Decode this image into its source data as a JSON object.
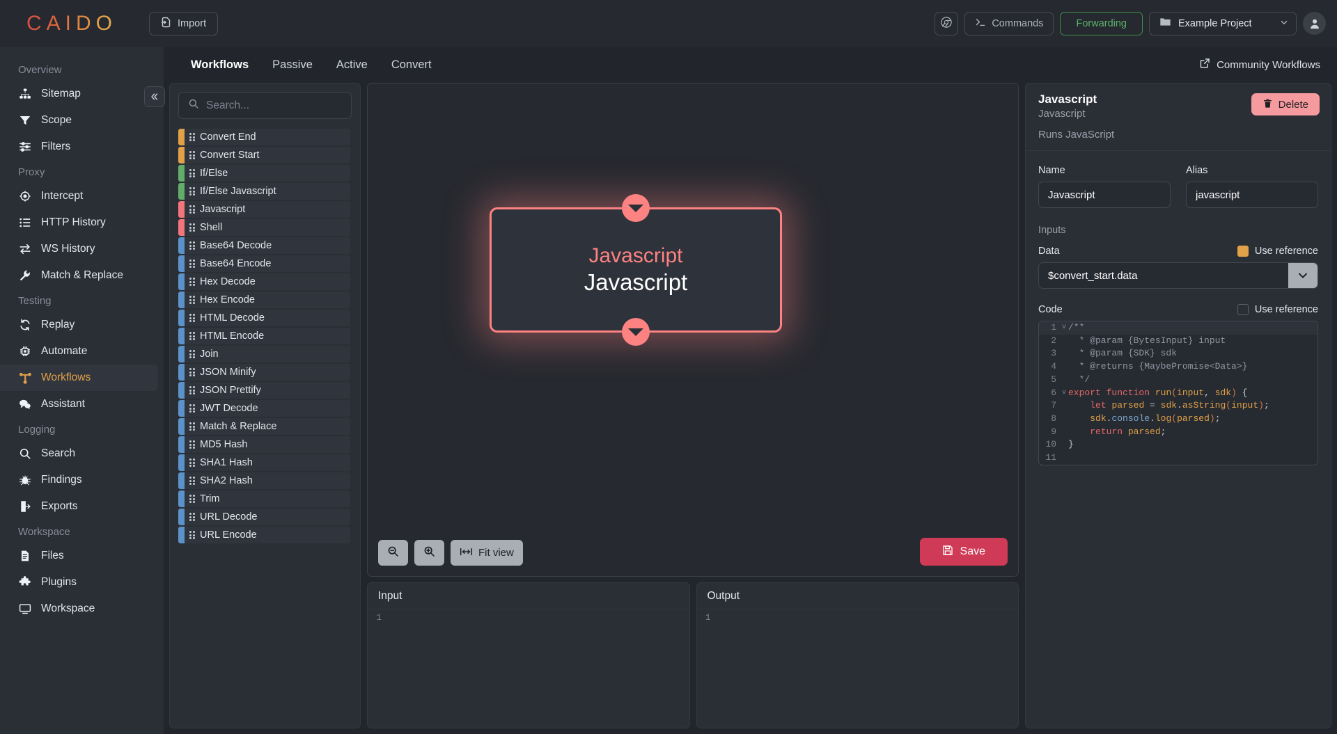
{
  "topbar": {
    "logo": "CAIDO",
    "import_label": "Import",
    "commands_label": "Commands",
    "forwarding_label": "Forwarding",
    "project_label": "Example Project"
  },
  "sidebar": {
    "groups": [
      {
        "title": "Overview",
        "items": [
          {
            "label": "Sitemap",
            "icon": "sitemap-icon"
          },
          {
            "label": "Scope",
            "icon": "funnel-icon"
          },
          {
            "label": "Filters",
            "icon": "sliders-icon"
          }
        ]
      },
      {
        "title": "Proxy",
        "items": [
          {
            "label": "Intercept",
            "icon": "target-icon"
          },
          {
            "label": "HTTP History",
            "icon": "list-icon"
          },
          {
            "label": "WS History",
            "icon": "exchange-icon"
          },
          {
            "label": "Match & Replace",
            "icon": "wrench-icon"
          }
        ]
      },
      {
        "title": "Testing",
        "items": [
          {
            "label": "Replay",
            "icon": "refresh-icon"
          },
          {
            "label": "Automate",
            "icon": "chip-icon"
          },
          {
            "label": "Workflows",
            "icon": "workflow-icon",
            "active": true
          },
          {
            "label": "Assistant",
            "icon": "chat-icon"
          }
        ]
      },
      {
        "title": "Logging",
        "items": [
          {
            "label": "Search",
            "icon": "search-icon"
          },
          {
            "label": "Findings",
            "icon": "bug-icon"
          },
          {
            "label": "Exports",
            "icon": "export-icon"
          }
        ]
      },
      {
        "title": "Workspace",
        "items": [
          {
            "label": "Files",
            "icon": "file-icon"
          },
          {
            "label": "Plugins",
            "icon": "plugin-icon"
          },
          {
            "label": "Workspace",
            "icon": "monitor-icon"
          }
        ]
      }
    ]
  },
  "tabs": [
    {
      "label": "Workflows",
      "active": true
    },
    {
      "label": "Passive",
      "active": false
    },
    {
      "label": "Active",
      "active": false
    },
    {
      "label": "Convert",
      "active": false
    }
  ],
  "community_label": "Community Workflows",
  "nodelist": {
    "search_placeholder": "Search...",
    "search_value": "",
    "items": [
      {
        "label": "Convert End",
        "color": "#e0a148"
      },
      {
        "label": "Convert Start",
        "color": "#e0a148"
      },
      {
        "label": "If/Else",
        "color": "#63ad6b"
      },
      {
        "label": "If/Else Javascript",
        "color": "#63ad6b"
      },
      {
        "label": "Javascript",
        "color": "#f2757b"
      },
      {
        "label": "Shell",
        "color": "#f2757b"
      },
      {
        "label": "Base64 Decode",
        "color": "#5b92c9"
      },
      {
        "label": "Base64 Encode",
        "color": "#5b92c9"
      },
      {
        "label": "Hex Decode",
        "color": "#5b92c9"
      },
      {
        "label": "Hex Encode",
        "color": "#5b92c9"
      },
      {
        "label": "HTML Decode",
        "color": "#5b92c9"
      },
      {
        "label": "HTML Encode",
        "color": "#5b92c9"
      },
      {
        "label": "Join",
        "color": "#5b92c9"
      },
      {
        "label": "JSON Minify",
        "color": "#5b92c9"
      },
      {
        "label": "JSON Prettify",
        "color": "#5b92c9"
      },
      {
        "label": "JWT Decode",
        "color": "#5b92c9"
      },
      {
        "label": "Match & Replace",
        "color": "#5b92c9"
      },
      {
        "label": "MD5 Hash",
        "color": "#5b92c9"
      },
      {
        "label": "SHA1 Hash",
        "color": "#5b92c9"
      },
      {
        "label": "SHA2 Hash",
        "color": "#5b92c9"
      },
      {
        "label": "Trim",
        "color": "#5b92c9"
      },
      {
        "label": "URL Decode",
        "color": "#5b92c9"
      },
      {
        "label": "URL Encode",
        "color": "#5b92c9"
      }
    ]
  },
  "canvas": {
    "node": {
      "type": "Javascript",
      "name": "Javascript",
      "accent": "#fd8282"
    },
    "zoom_out_label": "",
    "zoom_in_label": "",
    "fit_view_label": "Fit view",
    "save_label": "Save"
  },
  "io": {
    "input_title": "Input",
    "input_line_no": "1",
    "input_value": "",
    "output_title": "Output",
    "output_line_no": "1",
    "output_value": ""
  },
  "inspector": {
    "title": "Javascript",
    "subtitle": "Javascript",
    "description": "Runs JavaScript",
    "delete_label": "Delete",
    "name_label": "Name",
    "name_value": "Javascript",
    "alias_label": "Alias",
    "alias_value": "javascript",
    "inputs_label": "Inputs",
    "data_label": "Data",
    "data_use_reference_label": "Use reference",
    "data_use_reference_checked": true,
    "data_value": "$convert_start.data",
    "code_label": "Code",
    "code_use_reference_label": "Use reference",
    "code_use_reference_checked": false,
    "code_lines": [
      {
        "n": "1",
        "fold": "v",
        "t": "/**"
      },
      {
        "n": "2",
        "fold": "",
        "t": "  * @param {BytesInput} input"
      },
      {
        "n": "3",
        "fold": "",
        "t": "  * @param {SDK} sdk"
      },
      {
        "n": "4",
        "fold": "",
        "t": "  * @returns {MaybePromise<Data>}"
      },
      {
        "n": "5",
        "fold": "",
        "t": "  */"
      },
      {
        "n": "6",
        "fold": "v",
        "t": "export function run(input, sdk) {"
      },
      {
        "n": "7",
        "fold": "",
        "t": "    let parsed = sdk.asString(input);"
      },
      {
        "n": "8",
        "fold": "",
        "t": "    sdk.console.log(parsed);"
      },
      {
        "n": "9",
        "fold": "",
        "t": "    return parsed;"
      },
      {
        "n": "10",
        "fold": "",
        "t": "}"
      },
      {
        "n": "11",
        "fold": "",
        "t": ""
      }
    ]
  }
}
